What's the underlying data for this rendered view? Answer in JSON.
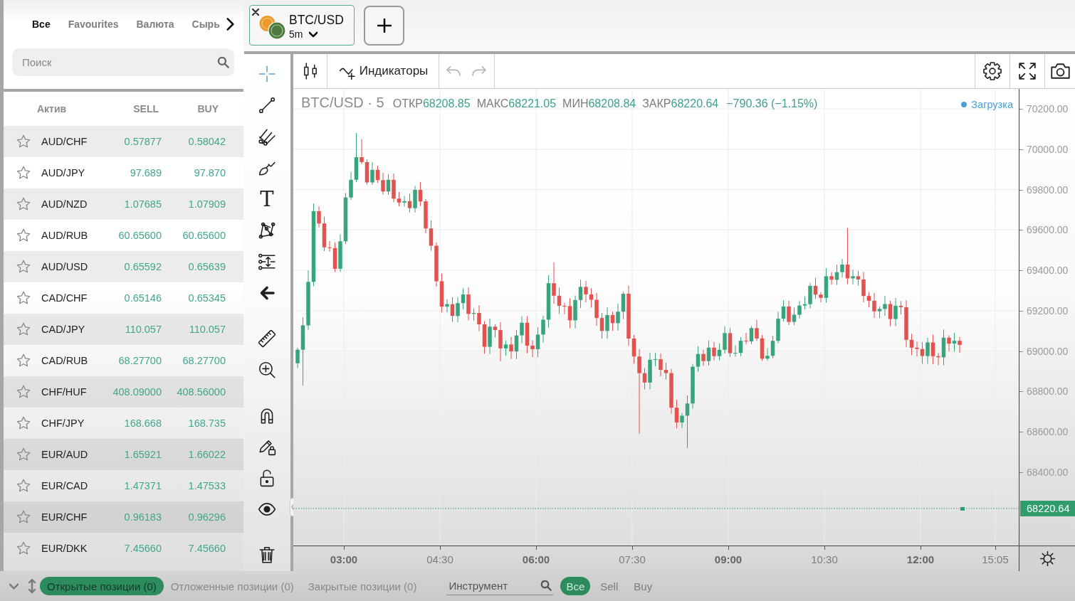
{
  "sidebar": {
    "tabs": [
      {
        "label": "Все",
        "selected": true
      },
      {
        "label": "Favourites",
        "selected": false
      },
      {
        "label": "Валюта",
        "selected": false
      },
      {
        "label": "Сырь",
        "selected": false
      }
    ],
    "search": {
      "placeholder": "Поиск"
    },
    "table": {
      "columns": [
        "Актив",
        "SELL",
        "BUY"
      ],
      "rows": [
        {
          "starred": false,
          "asset": "AUD/CHF",
          "sell": "0.57877",
          "buy": "0.58042"
        },
        {
          "starred": false,
          "asset": "AUD/JPY",
          "sell": "97.689",
          "buy": "97.870"
        },
        {
          "starred": false,
          "asset": "AUD/NZD",
          "sell": "1.07685",
          "buy": "1.07909"
        },
        {
          "starred": false,
          "asset": "AUD/RUB",
          "sell": "60.65600",
          "buy": "60.65600"
        },
        {
          "starred": false,
          "asset": "AUD/USD",
          "sell": "0.65592",
          "buy": "0.65639"
        },
        {
          "starred": false,
          "asset": "CAD/CHF",
          "sell": "0.65146",
          "buy": "0.65345"
        },
        {
          "starred": false,
          "asset": "CAD/JPY",
          "sell": "110.057",
          "buy": "110.057"
        },
        {
          "starred": false,
          "asset": "CAD/RUB",
          "sell": "68.27700",
          "buy": "68.27700"
        },
        {
          "starred": false,
          "asset": "CHF/HUF",
          "sell": "408.09000",
          "buy": "408.56000"
        },
        {
          "starred": false,
          "asset": "CHF/JPY",
          "sell": "168.668",
          "buy": "168.735"
        },
        {
          "starred": false,
          "asset": "EUR/AUD",
          "sell": "1.65921",
          "buy": "1.66022"
        },
        {
          "starred": false,
          "asset": "EUR/CAD",
          "sell": "1.47371",
          "buy": "1.47533"
        },
        {
          "starred": false,
          "asset": "EUR/CHF",
          "sell": "0.96183",
          "buy": "0.96296"
        },
        {
          "starred": false,
          "asset": "EUR/DKK",
          "sell": "7.45660",
          "buy": "7.45660"
        }
      ]
    }
  },
  "chart_tabs": [
    {
      "symbol": "BTC/USD",
      "interval": "5m",
      "selected": true
    }
  ],
  "drawing_tools": [
    [
      {
        "kind": "crosshair",
        "selected": true
      },
      {
        "kind": "trend_line",
        "selected": false
      },
      {
        "kind": "pitchfork",
        "selected": false
      },
      {
        "kind": "brush",
        "selected": false
      },
      {
        "kind": "text",
        "glyph": "T",
        "selected": false
      },
      {
        "kind": "pattern",
        "selected": false
      },
      {
        "kind": "projection",
        "selected": false
      },
      {
        "kind": "back_arrow",
        "selected": false
      }
    ],
    [
      {
        "kind": "ruler",
        "selected": false
      },
      {
        "kind": "zoom_in",
        "selected": false
      }
    ],
    [
      {
        "kind": "magnet",
        "selected": false
      },
      {
        "kind": "lock_drawings",
        "selected": false
      },
      {
        "kind": "lock",
        "selected": false
      },
      {
        "kind": "visibility",
        "selected": false
      }
    ],
    [
      {
        "kind": "remove",
        "selected": false
      }
    ]
  ],
  "chart_toolbar": {
    "indicators_label": "Индикаторы",
    "undo": {
      "disabled": true
    },
    "redo": {
      "disabled": true
    }
  },
  "chart": {
    "symbol": "BTC/USD · 5",
    "ohlc": [
      {
        "label": "ОТКР",
        "value": "68208.85"
      },
      {
        "label": "МАКС",
        "value": "68221.05"
      },
      {
        "label": "МИН",
        "value": "68208.84"
      },
      {
        "label": "ЗАКР",
        "value": "68220.64"
      }
    ],
    "change": "−790.36 (−1.15%)",
    "status": "Загрузка",
    "price_axis": [
      "70200.00",
      "70000.00",
      "69800.00",
      "69600.00",
      "69400.00",
      "69200.00",
      "69000.00",
      "68800.00",
      "68600.00",
      "68400.00"
    ],
    "last_price": "68220.64",
    "time_axis": [
      {
        "label": "03:00",
        "major": true
      },
      {
        "label": "04:30",
        "major": false
      },
      {
        "label": "06:00",
        "major": true
      },
      {
        "label": "07:30",
        "major": false
      },
      {
        "label": "09:00",
        "major": true
      },
      {
        "label": "10:30",
        "major": false
      },
      {
        "label": "12:00",
        "major": true
      },
      {
        "label": "15:05",
        "major": false
      }
    ]
  },
  "positions_bar": {
    "tabs": [
      {
        "label": "Открытые позиции (0)",
        "selected": true
      },
      {
        "label": "Отложенные позиции (0)",
        "selected": false
      },
      {
        "label": "Закрытые позиции (0)",
        "selected": false
      }
    ],
    "instrument_filter": {
      "placeholder": "Инструмент"
    },
    "side_filters": [
      {
        "label": "Все",
        "selected": true
      },
      {
        "label": "Sell",
        "selected": false
      },
      {
        "label": "Buy",
        "selected": false
      }
    ]
  }
}
